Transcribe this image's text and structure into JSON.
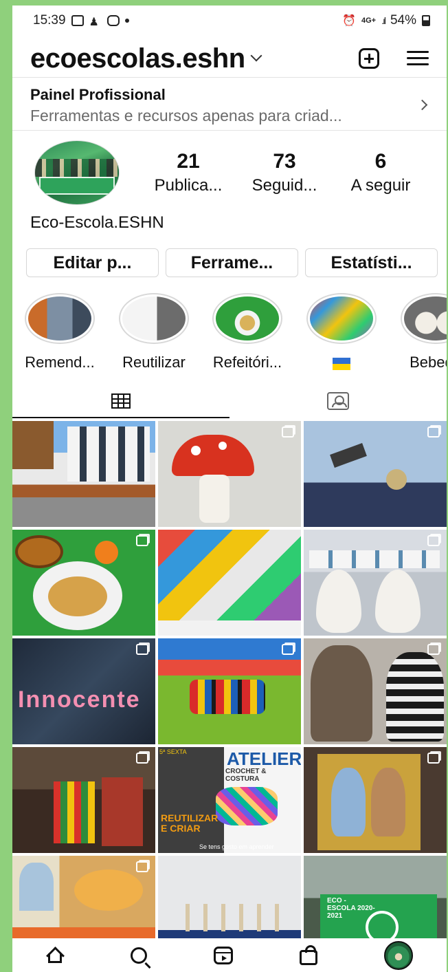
{
  "status_bar": {
    "time": "15:39",
    "network": "4G+",
    "battery": "54%"
  },
  "header": {
    "username": "ecoescolas.eshn"
  },
  "pro_panel": {
    "title": "Painel Profissional",
    "subtitle": "Ferramentas e recursos apenas para criad..."
  },
  "profile": {
    "display_name": "Eco-Escola.ESHN",
    "stats": [
      {
        "value": "21",
        "label": "Publica..."
      },
      {
        "value": "73",
        "label": "Seguid..."
      },
      {
        "value": "6",
        "label": "A seguir"
      }
    ]
  },
  "buttons": {
    "edit": "Editar p...",
    "tools": "Ferrame...",
    "stats": "Estatísti..."
  },
  "highlights": [
    {
      "label": "Remend..."
    },
    {
      "label": "Reutilizar"
    },
    {
      "label": "Refeitóri..."
    },
    {
      "label": "",
      "flag": "ukraine-flag"
    },
    {
      "label": "Bebedo"
    }
  ],
  "grid_texts": {
    "atelier_title": "ATELIER",
    "atelier_sub": "CROCHET & COSTURA",
    "atelier_reuse": "REUTILIZAR E CRIAR",
    "atelier_footer": "Se tens gosto em aprender",
    "atelier_top": "5ª SEXTA",
    "mural_text": "Innocente",
    "flag_text": "ECO - ESCOLA 2020-2021"
  },
  "icons": {
    "new_post": "plus-square-icon",
    "menu": "hamburger-icon",
    "posts_tab": "grid-icon",
    "tagged_tab": "tagged-user-icon",
    "nav": [
      "home-icon",
      "search-icon",
      "reels-icon",
      "shop-icon",
      "profile-avatar"
    ]
  },
  "colors": {
    "background_border": "#8fd07c",
    "text": "#111111",
    "muted": "#6b6b6b"
  }
}
